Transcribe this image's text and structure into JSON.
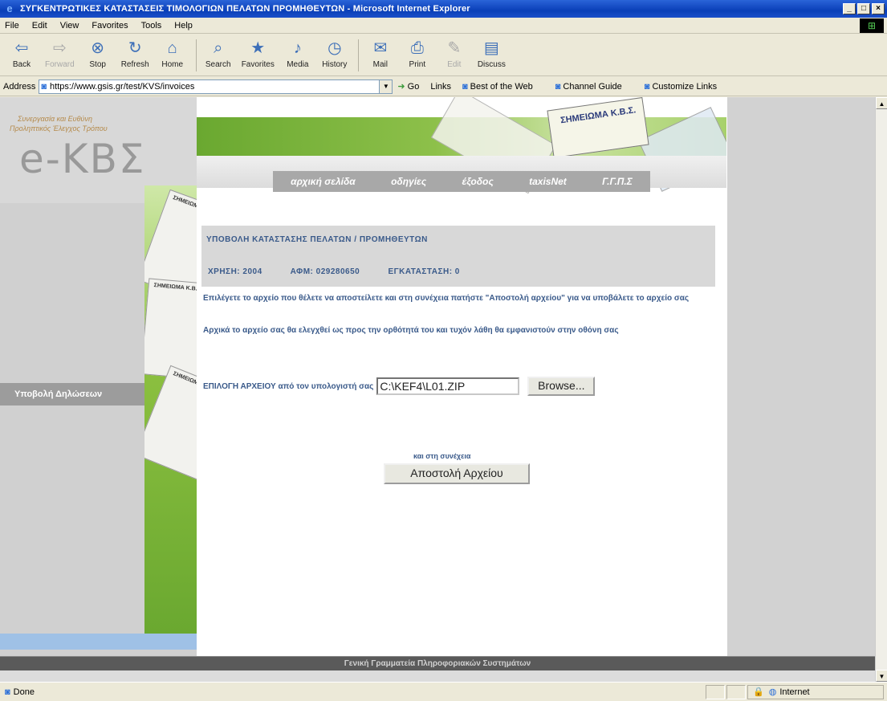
{
  "window": {
    "title": "ΣΥΓΚΕΝΤΡΩΤΙΚΕΣ ΚΑΤΑΣΤΑΣΕΙΣ ΤΙΜΟΛΟΓΙΩΝ ΠΕΛΑΤΩΝ ΠΡΟΜΗΘΕΥΤΩΝ - Microsoft Internet Explorer",
    "minimize": "_",
    "maximize": "□",
    "close": "×"
  },
  "menu": [
    "File",
    "Edit",
    "View",
    "Favorites",
    "Tools",
    "Help"
  ],
  "toolbar": {
    "back": "Back",
    "forward": "Forward",
    "stop": "Stop",
    "refresh": "Refresh",
    "home": "Home",
    "search": "Search",
    "favorites": "Favorites",
    "media": "Media",
    "history": "History",
    "mail": "Mail",
    "print": "Print",
    "edit": "Edit",
    "discuss": "Discuss"
  },
  "address": {
    "label": "Address",
    "url": "https://www.gsis.gr/test/KVS/invoices",
    "go": "Go",
    "links_label": "Links",
    "links": [
      "Best of the Web",
      "Channel Guide",
      "Customize Links"
    ]
  },
  "sidebar": {
    "tagline1": "Συνεργασία και Ευθύνη",
    "tagline2": "Προληπτικός Έλεγχος Τρόπου",
    "logo": "e-ΚΒΣ",
    "nav_item": "Υποβολή Δηλώσεων"
  },
  "banner": {
    "stamp_title": "ΣΗΜΕΙΩΜΑ Κ.Β.Σ.",
    "nav": [
      "αρχική σελίδα",
      "οδηγίες",
      "έξοδος",
      "taxisNet",
      "Γ.Γ.Π.Σ"
    ]
  },
  "form": {
    "heading": "ΥΠΟΒΟΛΗ ΚΑΤΑΣΤΑΣΗΣ ΠΕΛΑΤΩΝ / ΠΡΟΜΗΘΕΥΤΩΝ",
    "year": "ΧΡΗΣΗ: 2004",
    "afm": "ΑΦΜ: 029280650",
    "installation": "ΕΓΚΑΤΑΣΤΑΣΗ: 0",
    "instruction1": "Επιλέγετε το αρχείο που θέλετε να αποστείλετε και στη συνέχεια πατήστε \"Αποστολή αρχείου\" για να υποβάλετε το αρχείο σας",
    "instruction2": "Αρχικά το αρχείο σας θα ελεγχθεί ως προς την ορθότητά του και τυχόν λάθη θα εμφανιστούν στην οθόνη σας",
    "file_label": "ΕΠΙΛΟΓΗ ΑΡΧΕΙΟΥ από τον υπολογιστή σας",
    "file_value": "C:\\KEF4\\L01.ZIP",
    "browse": "Browse...",
    "submit_note": "και στη συνέχεια",
    "submit": "Αποστολή Αρχείου"
  },
  "footer": "Γενική Γραμματεία Πληροφοριακών Συστημάτων",
  "status": {
    "text": "Done",
    "zone": "Internet"
  }
}
